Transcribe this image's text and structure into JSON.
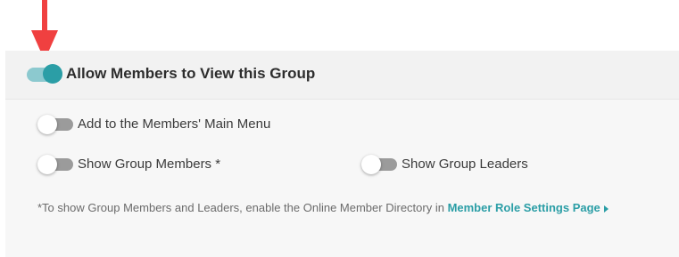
{
  "group_visibility": {
    "title": "Allow Members to View this Group",
    "enabled": true
  },
  "options": {
    "main_menu_label": "Add to the Members' Main Menu",
    "show_members_label": "Show Group Members *",
    "show_leaders_label": "Show Group Leaders"
  },
  "note": {
    "text": "*To show Group Members and Leaders, enable the Online Member Directory in ",
    "link_label": "Member Role Settings Page"
  },
  "colors": {
    "accent": "#2b9ea6",
    "annotation_arrow": "#f04040"
  },
  "icons": {
    "annotation": "red-arrow-down",
    "link": "caret-right-icon"
  }
}
